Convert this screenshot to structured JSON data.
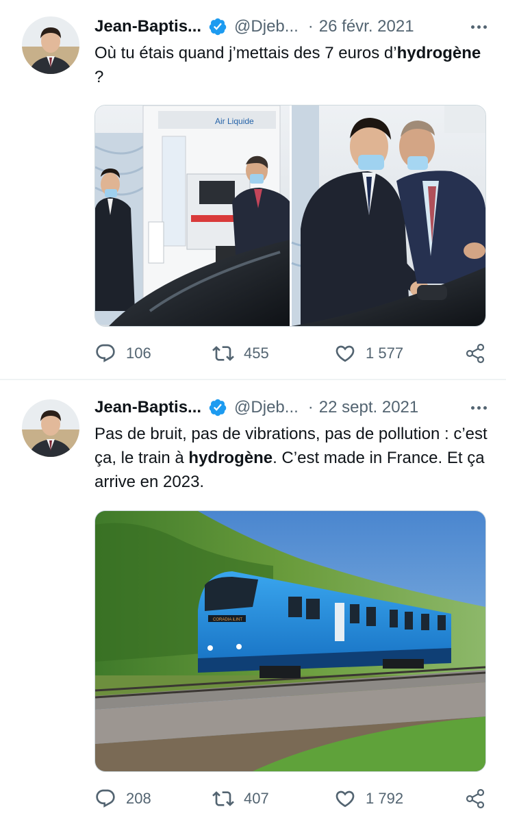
{
  "colors": {
    "accent": "#1d9bf0",
    "secondary_text": "#536471",
    "border": "#cfd9de"
  },
  "tweets": [
    {
      "author_name": "Jean-Baptis...",
      "handle": "@Djeb...",
      "separator": "·",
      "date": "26 févr. 2021",
      "text_before": "Où tu étais quand j’mettais des 7 euros d’",
      "text_bold": "hydrogène",
      "text_after": " ?",
      "media_alt": "Air Liquide",
      "reply_count": "106",
      "retweet_count": "455",
      "like_count": "1 577"
    },
    {
      "author_name": "Jean-Baptis...",
      "handle": "@Djeb...",
      "separator": "·",
      "date": "22 sept. 2021",
      "text_before": "Pas de bruit, pas de vibrations, pas de pollution : c’est ça, le train à ",
      "text_bold": "hydrogène",
      "text_after": ". C’est made in France. Et ça arrive en 2023.",
      "media_alt": "CORADIA iLINT",
      "reply_count": "208",
      "retweet_count": "407",
      "like_count": "1 792"
    }
  ],
  "icons": {
    "verified": "verified-badge-icon",
    "more": "more-icon",
    "reply": "reply-icon",
    "retweet": "retweet-icon",
    "like": "heart-icon",
    "share": "share-icon"
  }
}
